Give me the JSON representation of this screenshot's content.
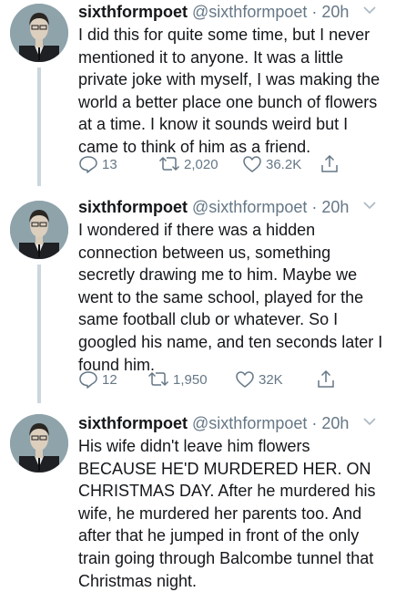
{
  "tweets": [
    {
      "name": "sixthformpoet",
      "handle": "@sixthformpoet",
      "dot": "·",
      "time": "20h",
      "text": "I did this for quite some time, but I never mentioned it to anyone. It was a little private joke with myself, I was making the world a better place one bunch of flowers at a time. I know it sounds weird but I came to think of him as a friend.",
      "replies": "13",
      "retweets": "2,020",
      "likes": "36.2K"
    },
    {
      "name": "sixthformpoet",
      "handle": "@sixthformpoet",
      "dot": "·",
      "time": "20h",
      "text": "I wondered if there was a hidden connection between us, something secretly drawing me to him. Maybe we went to the same school, played for the same football club or whatever. So I googled his name, and ten seconds later I found him.",
      "replies": "12",
      "retweets": "1,950",
      "likes": "32K"
    },
    {
      "name": "sixthformpoet",
      "handle": "@sixthformpoet",
      "dot": "·",
      "time": "20h",
      "text": "His wife didn't leave him flowers BECAUSE HE'D MURDERED HER. ON CHRISTMAS DAY. After he murdered his wife, he murdered her parents too. And after that he jumped in front of the only train going through Balcombe tunnel that Christmas night."
    }
  ],
  "colors": {
    "text": "#14171a",
    "muted": "#657786",
    "thread_line": "#ccd6dd"
  },
  "icons": [
    "reply-icon",
    "retweet-icon",
    "like-icon",
    "share-icon",
    "chevron-down-icon",
    "avatar"
  ]
}
